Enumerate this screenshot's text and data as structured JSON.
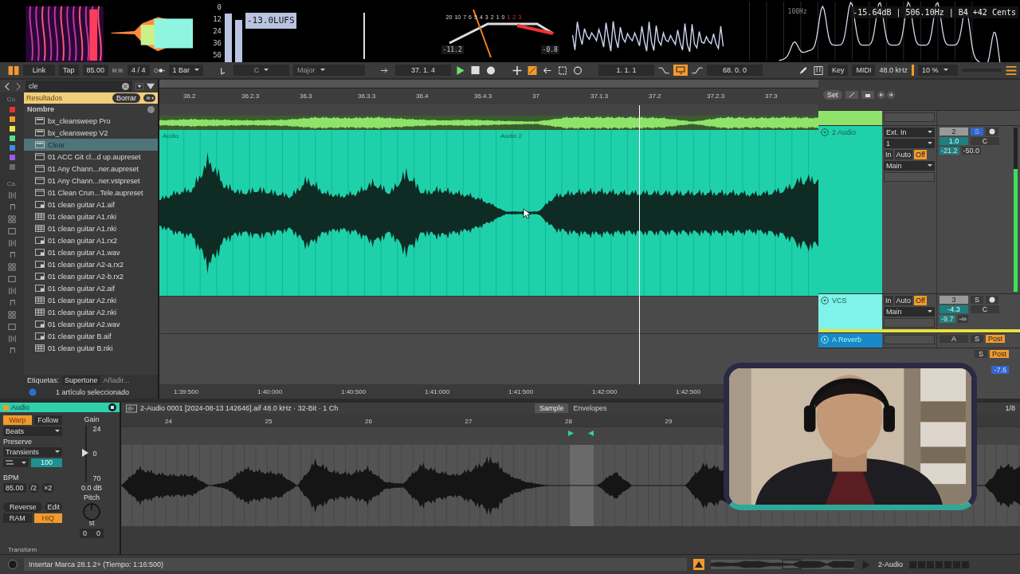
{
  "visualizers": {
    "meter_scale": [
      "0",
      "12",
      "24",
      "36",
      "50"
    ],
    "loudness": "-13.0LUFS",
    "vu_scale": [
      "20",
      "10",
      "7",
      "6",
      "5",
      "4",
      "3",
      "2",
      "1",
      "0",
      "1",
      "2",
      "3"
    ],
    "vu_left_reading": "-11.2",
    "vu_right_reading": "-0.8",
    "spectrum_marker": "100Hz",
    "pitch_readout": "-15.64dB | 506.10Hz | B4  +42 Cents"
  },
  "transport": {
    "link": "Link",
    "tap": "Tap",
    "tempo": "85.00",
    "signature": "4 / 4",
    "quantize": "1 Bar",
    "key": "C",
    "scale": "Major",
    "position": "37. 1. 4",
    "loop_start": "1. 1. 1",
    "loop_on": true,
    "loop_length": "68. 0. 0",
    "key_map": "Key",
    "midi_map": "MIDI",
    "sample_rate": "48.0 kHz",
    "cpu": "10 %"
  },
  "browser": {
    "search": "cle",
    "results_label": "Resultados",
    "clear": "Borrar",
    "column": "Nombre",
    "collections_label": "Co.",
    "categories_label": "Ca.",
    "collections": [
      {
        "color": "#e5352b"
      },
      {
        "color": "#f29a2e"
      },
      {
        "color": "#ece64a"
      },
      {
        "color": "#4fe38e"
      },
      {
        "color": "#3b8ee0"
      },
      {
        "color": "#9b5de5"
      },
      {
        "color": "#6b6b6b"
      }
    ],
    "items": [
      {
        "name": "bx_cleansweep Pro",
        "kind": "plugin",
        "selected": false
      },
      {
        "name": "bx_cleansweep V2",
        "kind": "plugin",
        "selected": false
      },
      {
        "name": "Clear",
        "kind": "plugin",
        "selected": true
      },
      {
        "name": "01 ACC Git cl...d up.aupreset",
        "kind": "preset",
        "selected": false
      },
      {
        "name": "01 Any Chann...ner.aupreset",
        "kind": "preset",
        "selected": false
      },
      {
        "name": "01 Any Chann...ner.vstpreset",
        "kind": "preset",
        "selected": false
      },
      {
        "name": "01 Clean Crun...Tele.aupreset",
        "kind": "preset",
        "selected": false
      },
      {
        "name": "01 clean guitar A1.aif",
        "kind": "audio",
        "selected": false
      },
      {
        "name": "01 clean guitar A1.nki",
        "kind": "instrument",
        "selected": false
      },
      {
        "name": "01 clean guitar A1.nki",
        "kind": "instrument",
        "selected": false
      },
      {
        "name": "01 clean guitar A1.rx2",
        "kind": "audio",
        "selected": false
      },
      {
        "name": "01 clean guitar A1.wav",
        "kind": "audio",
        "selected": false
      },
      {
        "name": "01 clean guitar A2-a.rx2",
        "kind": "audio",
        "selected": false
      },
      {
        "name": "01 clean guitar A2-b.rx2",
        "kind": "audio",
        "selected": false
      },
      {
        "name": "01 clean guitar A2.aif",
        "kind": "audio",
        "selected": false
      },
      {
        "name": "01 clean guitar A2.nki",
        "kind": "instrument",
        "selected": false
      },
      {
        "name": "01 clean guitar A2.nki",
        "kind": "instrument",
        "selected": false
      },
      {
        "name": "01 clean guitar A2.wav",
        "kind": "audio",
        "selected": false
      },
      {
        "name": "01 clean guitar B.aif",
        "kind": "audio",
        "selected": false
      },
      {
        "name": "01 clean guitar B.nki",
        "kind": "instrument",
        "selected": false
      }
    ],
    "tags_label": "Etiquetas:",
    "tag": "Supertone",
    "add_tag": "Añadir...",
    "status": "1 artículo seleccionado"
  },
  "arrangement": {
    "set": "Set",
    "ruler": [
      "36.2",
      "36.2.3",
      "36.3",
      "36.3.3",
      "36.4",
      "36.4.3",
      "37",
      "37.1.3",
      "37.2",
      "37.2.3",
      "37.3"
    ],
    "clips": [
      "Audio",
      "Audio 2"
    ],
    "time_ruler": [
      "1:39:500",
      "1:40:000",
      "1:40:500",
      "1:41:000",
      "1:41:500",
      "1:42:000",
      "1:42:500"
    ]
  },
  "tracks": [
    {
      "name": "2 Audio",
      "color": "#1fd1aa",
      "input_type": "Ext. In",
      "input_channel": "1",
      "monitor": [
        {
          "label": "In",
          "selected": false
        },
        {
          "label": "Auto",
          "selected": false
        },
        {
          "label": "Off",
          "selected": true
        }
      ],
      "output": "Main",
      "number": "2",
      "solo": "S",
      "solo_on": true,
      "volume": "1.0",
      "pan": "C",
      "peak": "-21.2",
      "peak_low": "-50.0",
      "level": 0.75
    },
    {
      "name": "VCS",
      "color": "#7ff3ea",
      "monitor": [
        {
          "label": "In",
          "selected": false
        },
        {
          "label": "Auto",
          "selected": false
        },
        {
          "label": "Off",
          "selected": true
        }
      ],
      "output": "Main",
      "number": "3",
      "solo": "S",
      "solo_on": false,
      "volume": "-4.3",
      "pan": "C",
      "peak": "-9.7",
      "peak_low": "-∞"
    }
  ],
  "returns": [
    {
      "name": "A Reverb",
      "send": "A",
      "solo": "S",
      "mode": "Post"
    }
  ],
  "master": {
    "solo": "S",
    "mode": "Post",
    "volume": "-7.6"
  },
  "clip": {
    "name": "Audio",
    "warp": "Warp",
    "warp_on": true,
    "follow": "Follow",
    "warp_mode": "Beats",
    "preserve_label": "Preserve",
    "preserve": "Transients",
    "envelope": "100",
    "bpm_label": "BPM",
    "bpm": "85.00",
    "half": "/2",
    "double": "×2",
    "gain_label": "Gain",
    "gain_slider": {
      "level": 0.52
    },
    "gain_scale": [
      "24",
      "0",
      "70"
    ],
    "gain": "0.0 dB",
    "pitch_label": "Pitch",
    "pitch_unit": "st",
    "transpose": "0",
    "detune": "0",
    "reverse": "Reverse",
    "edit": "Edit",
    "ram": "RAM",
    "hiq": "HiQ",
    "hiq_on": true,
    "transform": "Transform"
  },
  "sample_editor": {
    "file": "2-Audio 0001 [2024-08-13 142646].aif  48.0 kHz · 32-Bit · 1 Ch",
    "tabs": [
      {
        "label": "Sample",
        "selected": true
      },
      {
        "label": "Envelopes",
        "selected": false
      }
    ],
    "grid": "1/8",
    "ruler": [
      "24",
      "25",
      "26",
      "27",
      "28",
      "29"
    ]
  },
  "status_bar": {
    "message": "Insertar Marca 28.1.2+ (Tiempo: 1:16:500)",
    "track": "2-Audio"
  }
}
